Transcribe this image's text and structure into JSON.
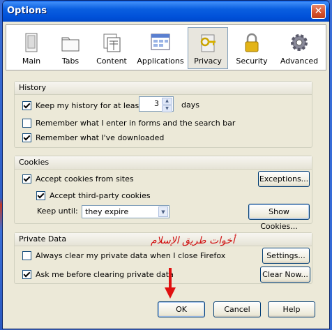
{
  "window": {
    "title": "Options"
  },
  "tabs": [
    {
      "label": "Main",
      "icon": "main-icon"
    },
    {
      "label": "Tabs",
      "icon": "tabs-icon"
    },
    {
      "label": "Content",
      "icon": "content-icon"
    },
    {
      "label": "Applications",
      "icon": "applications-icon"
    },
    {
      "label": "Privacy",
      "icon": "privacy-icon",
      "selected": true
    },
    {
      "label": "Security",
      "icon": "security-icon"
    },
    {
      "label": "Advanced",
      "icon": "advanced-icon"
    }
  ],
  "history": {
    "title": "History",
    "keep_history_label": "Keep my history for at least",
    "keep_history_checked": true,
    "days_value": "3",
    "days_label": "days",
    "remember_forms_label": "Remember what I enter in forms and the search bar",
    "remember_forms_checked": false,
    "remember_downloads_label": "Remember what I've downloaded",
    "remember_downloads_checked": true
  },
  "cookies": {
    "title": "Cookies",
    "accept_label": "Accept cookies from sites",
    "accept_checked": true,
    "third_party_label": "Accept third-party cookies",
    "third_party_checked": true,
    "keep_until_label": "Keep until:",
    "keep_until_value": "they expire",
    "exceptions_button": "Exceptions...",
    "show_cookies_button": "Show Cookies..."
  },
  "private_data": {
    "title": "Private Data",
    "always_clear_label": "Always clear my private data when I close Firefox",
    "always_clear_checked": false,
    "ask_label": "Ask me before clearing private data",
    "ask_checked": true,
    "settings_button": "Settings...",
    "clear_now_button": "Clear Now..."
  },
  "overlay_text": "أخوات طريق الإسلام",
  "buttons": {
    "ok": "OK",
    "cancel": "Cancel",
    "help": "Help"
  },
  "colors": {
    "titlebar": "#0a5fe0",
    "dialog_bg": "#ece9d8",
    "annotation": "#d01010"
  }
}
